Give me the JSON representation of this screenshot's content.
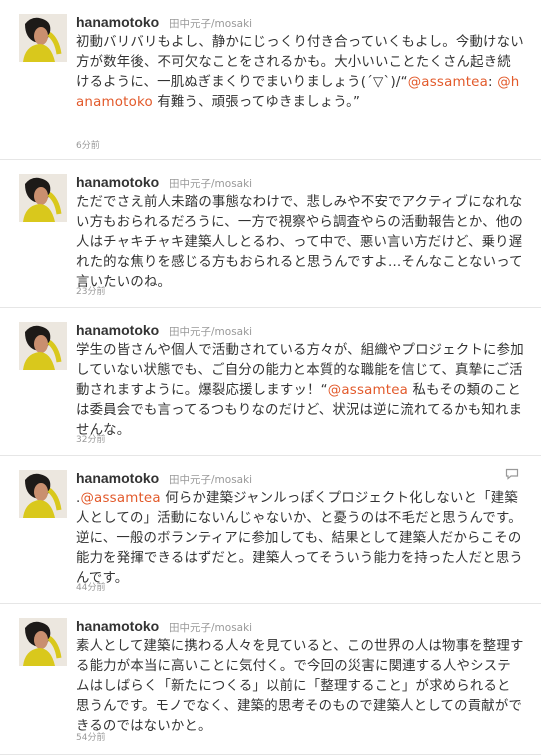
{
  "accent_color": "#e2592a",
  "tweets": [
    {
      "user": "hanamotoko",
      "screen": "田中元子/mosaki",
      "text_parts": [
        "初動バリバリもよし、静かにじっくり付き合っていくもよし。今動けない方が数年後、不可欠なことをされるかも。大小いいことたくさん起き続けるように、一肌ぬぎまくりでまいりましょう(´▽`)/“",
        "@assamtea",
        ": ",
        "@hanamotoko",
        " 有難う、頑張ってゆきましょう。”"
      ],
      "time": "6分前"
    },
    {
      "user": "hanamotoko",
      "screen": "田中元子/mosaki",
      "text_parts": [
        "ただでさえ前人未踏の事態なわけで、悲しみや不安でアクティブになれない方もおられるだろうに、一方で視察やら調査やらの活動報告とか、他の人はチャキチャキ建築人しとるわ、って中で、悪い言い方だけど、乗り遅れた的な焦りを感じる方もおられると思うんですよ…そんなことないって言いたいのね。"
      ],
      "time": "23分前"
    },
    {
      "user": "hanamotoko",
      "screen": "田中元子/mosaki",
      "text_parts": [
        "学生の皆さんや個人で活動されている方々が、組織やプロジェクトに参加していない状態でも、ご自分の能力と本質的な職能を信じて、真摯にご活動されますように。爆裂応援しますッ！“",
        "@assamtea",
        " 私もその類のことは委員会でも言ってるつもりなのだけど、状況は逆に流れてるかも知れませんな。"
      ],
      "time": "32分前"
    },
    {
      "user": "hanamotoko",
      "screen": "田中元子/mosaki",
      "text_parts": [
        ".",
        "@assamtea",
        " 何らか建築ジャンルっぽくプロジェクト化しないと「建築人としての」活動にないんじゃないか、と憂うのは不毛だと思うんです。逆に、一般のボランティアに参加しても、結果として建築人だからこその能力を発揮できるはずだと。建築人ってそういう能力を持った人だと思うんです。"
      ],
      "time": "44分前"
    },
    {
      "user": "hanamotoko",
      "screen": "田中元子/mosaki",
      "text_parts": [
        "素人として建築に携わる人々を見ていると、この世界の人は物事を整理する能力が本当に高いことに気付く。で今回の災害に関連する人やシステムはしばらく「新たにつくる」以前に「整理すること」が求められると思うんです。モノでなく、建築的思考そのもので建築人としての貢献ができるのではないかと。"
      ],
      "time": "54分前"
    }
  ]
}
